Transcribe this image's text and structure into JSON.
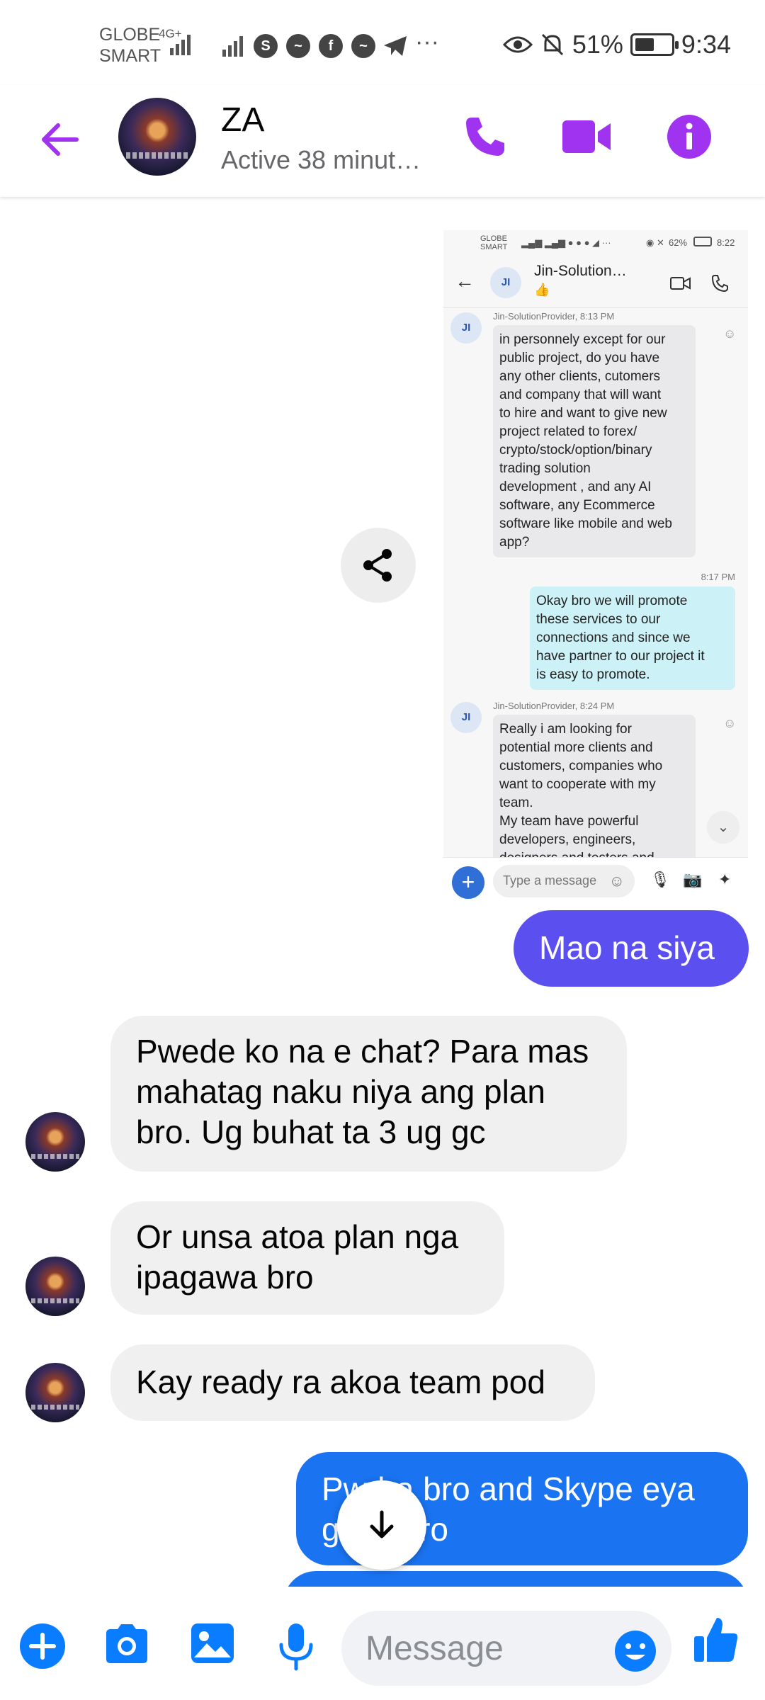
{
  "status_bar": {
    "carrier_line1": "GLOBE",
    "carrier_line2": "SMART",
    "network": "4G+",
    "battery": "51%",
    "time": "9:34"
  },
  "header": {
    "name": "ZA",
    "status": "Active 38 minut…"
  },
  "shared_screenshot": {
    "status_time": "8:22",
    "status_battery": "62%",
    "contact_initials": "JI",
    "contact_name": "Jin-Solution…",
    "contact_emoji": "👍",
    "messages": [
      {
        "direction": "in",
        "meta": "Jin-SolutionProvider, 8:13 PM",
        "lines": [
          "in personnely except for our",
          "public project, do you have",
          "any other clients, cutomers",
          "and company that will want",
          "to hire and want to give new",
          "project related to forex/",
          "crypto/stock/option/binary",
          "trading solution",
          "development , and any AI",
          "software, any Ecommerce",
          "software like mobile and web",
          "app?"
        ]
      },
      {
        "direction": "out",
        "meta": "8:17 PM",
        "lines": [
          "Okay bro we will promote",
          "these services to our",
          "connections and since we",
          "have partner to our project it",
          "is easy to promote."
        ]
      },
      {
        "direction": "in",
        "meta": "Jin-SolutionProvider, 8:24 PM",
        "lines": [
          "Really i am looking for",
          "potential more clients and",
          "customers, companies who",
          "want to cooperate with my",
          "team.",
          "My team have powerful",
          "developers, engineers,",
          "designers and testers and"
        ]
      }
    ],
    "input_placeholder": "Type a message"
  },
  "messages": [
    {
      "direction": "out",
      "text": "Mao na siya",
      "color": "#5b4ff0"
    },
    {
      "direction": "in",
      "lines": [
        "Pwede ko na e chat? Para mas",
        "mahatag naku niya ang plan",
        "bro. Ug buhat ta 3 ug gc"
      ]
    },
    {
      "direction": "in",
      "lines": [
        "Or unsa atoa plan nga",
        "ipagawa bro"
      ]
    },
    {
      "direction": "in",
      "lines": [
        "Kay ready ra akoa team pod"
      ]
    },
    {
      "direction": "out",
      "lines": [
        "Pwdra bro and Skype eya",
        "gasd bro"
      ],
      "color": "#1a73f0"
    }
  ],
  "composer": {
    "placeholder": "Message"
  },
  "colors": {
    "accent_purple": "#a033f0",
    "messenger_blue": "#0a7cff",
    "outgoing_purple": "#5b4ff0",
    "outgoing_blue": "#1a73f0",
    "incoming_bg": "#f0f0f0"
  },
  "icons": [
    "back-arrow-icon",
    "phone-icon",
    "video-call-icon",
    "info-icon",
    "share-icon",
    "arrow-down-icon",
    "plus-icon",
    "camera-icon",
    "gallery-icon",
    "microphone-icon",
    "emoji-icon",
    "thumbs-up-icon"
  ]
}
